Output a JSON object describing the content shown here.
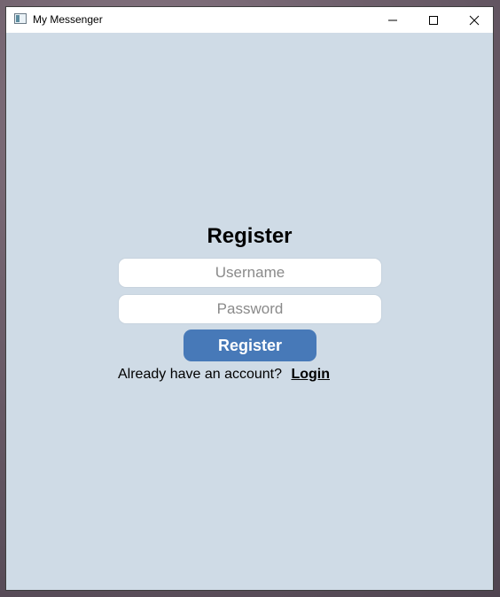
{
  "window": {
    "title": "My Messenger",
    "icon": "app-window-icon"
  },
  "titlebar": {
    "minimize_icon": "minimize-icon",
    "maximize_icon": "maximize-icon",
    "close_icon": "close-icon"
  },
  "form": {
    "heading": "Register",
    "username_placeholder": "Username",
    "password_placeholder": "Password",
    "username_value": "",
    "password_value": "",
    "submit_label": "Register",
    "footer_text": "Already have an account?",
    "login_link": "Login"
  },
  "colors": {
    "background": "#cfdbe6",
    "button": "#4779b8",
    "button_text": "#ffffff"
  }
}
